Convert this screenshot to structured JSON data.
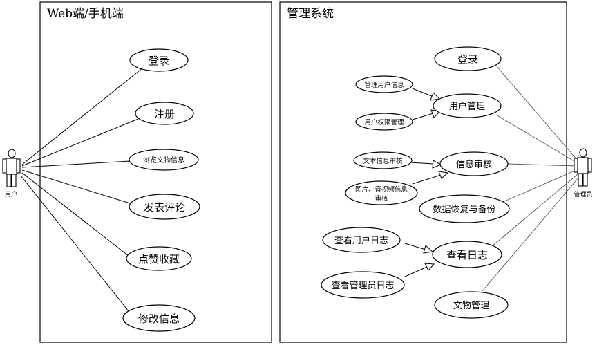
{
  "systems": {
    "web": {
      "title": "Web端/手机端"
    },
    "admin": {
      "title": "管理系统"
    }
  },
  "actors": {
    "user": {
      "label": "用户"
    },
    "admin": {
      "label": "管理员"
    }
  },
  "web_usecases": [
    {
      "label": "登录"
    },
    {
      "label": "注册"
    },
    {
      "label": "浏览文物信息"
    },
    {
      "label": "发表评论"
    },
    {
      "label": "点赞收藏"
    },
    {
      "label": "修改信息"
    }
  ],
  "admin_usecases": {
    "login": {
      "label": "登录"
    },
    "user_mgmt": {
      "label": "用户管理"
    },
    "user_info": {
      "label": "管理用户信息"
    },
    "user_perm": {
      "label": "用户权限管理"
    },
    "info_review": {
      "label": "信息审核"
    },
    "text_review": {
      "label": "文本信息审核"
    },
    "media_review": {
      "label_line1": "图片、音视频信息",
      "label_line2": "审核"
    },
    "backup": {
      "label": "数据恢复与备份"
    },
    "logs": {
      "label": "查看日志"
    },
    "user_logs": {
      "label": "查看用户日志"
    },
    "admin_logs": {
      "label": "查看管理员日志"
    },
    "artifact_mgmt": {
      "label": "文物管理"
    }
  }
}
